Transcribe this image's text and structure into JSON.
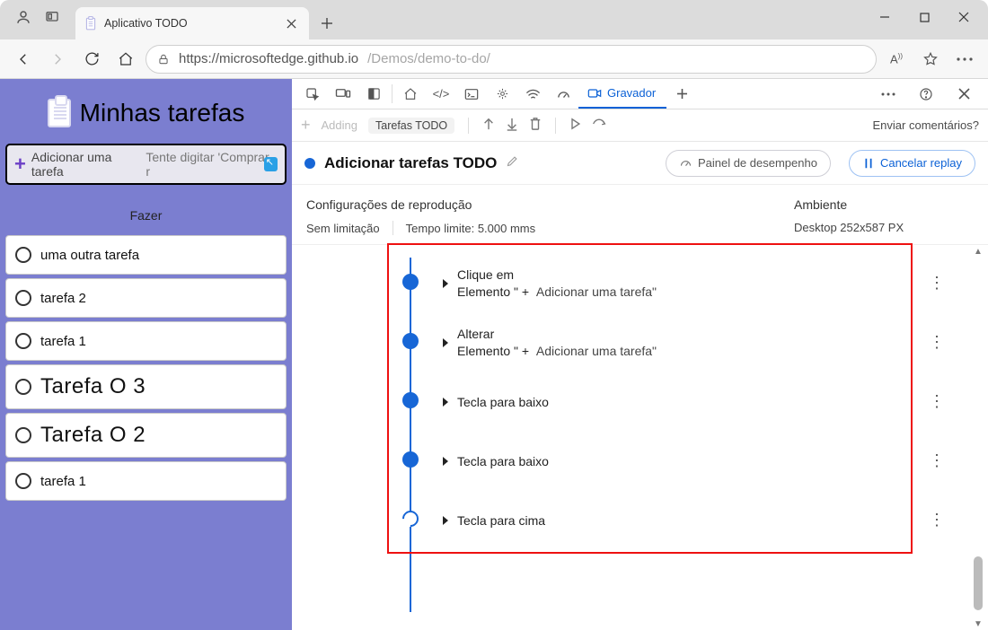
{
  "window": {
    "tab_title": "Aplicativo TODO"
  },
  "address": {
    "scheme_host": "https://microsoftedge.github.io",
    "path": "/Demos/demo-to-do/"
  },
  "app": {
    "title": "Minhas tarefas",
    "add_label": "Adicionar uma tarefa",
    "add_hint": "Tente digitar 'Comprar r",
    "section_label": "Fazer",
    "todos": [
      {
        "text": "uma outra tarefa",
        "big": false
      },
      {
        "text": "tarefa 2",
        "big": false
      },
      {
        "text": "tarefa 1",
        "big": false
      },
      {
        "text": "Tarefa O 3",
        "big": true
      },
      {
        "text": "Tarefa O 2",
        "big": true
      },
      {
        "text": "tarefa 1",
        "big": false
      }
    ]
  },
  "devtools": {
    "recorder_tab": "Gravador",
    "subbar": {
      "adding": "Adding",
      "chip": "Tarefas TODO"
    },
    "feedback": "Enviar comentários?",
    "recording_title": "Adicionar tarefas TODO",
    "perf_btn": "Painel de desempenho",
    "cancel_btn": "Cancelar replay",
    "settings": {
      "left_label": "Configurações de reprodução",
      "limit": "Sem limitação",
      "timeout": "Tempo limite: 5.000 mms",
      "env_label": "Ambiente",
      "env_value": "Desktop 252x587 PX"
    },
    "steps": [
      {
        "line1": "Clique em",
        "line2_pre": "Elemento \" + ",
        "line2_suf": "Adicionar uma tarefa\""
      },
      {
        "line1": "Alterar",
        "line2_pre": "Elemento \" + ",
        "line2_suf": "Adicionar uma tarefa\""
      },
      {
        "line1": "Tecla para baixo",
        "line2_pre": "",
        "line2_suf": ""
      },
      {
        "line1": "Tecla para baixo",
        "line2_pre": "",
        "line2_suf": ""
      },
      {
        "line1": "Tecla para cima",
        "line2_pre": "",
        "line2_suf": ""
      }
    ]
  }
}
